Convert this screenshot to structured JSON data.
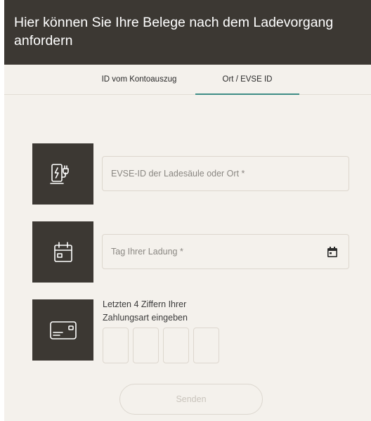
{
  "header": {
    "title": "Hier können Sie Ihre Belege nach dem Ladevorgang anfordern"
  },
  "tabs": [
    {
      "label": "ID vom Kontoauszug",
      "active": false
    },
    {
      "label": "Ort / EVSE ID",
      "active": true
    }
  ],
  "form": {
    "location": {
      "placeholder": "EVSE-ID der Ladesäule oder Ort *",
      "value": "",
      "icon": "charging-station-icon"
    },
    "date": {
      "placeholder": "Tag Ihrer Ladung *",
      "value": "",
      "icon": "calendar-icon",
      "picker_icon": "calendar-small-icon"
    },
    "card_digits": {
      "label_line1": "Letzten 4 Ziffern Ihrer",
      "label_line2": "Zahlungsart eingeben",
      "digits": [
        "",
        "",
        "",
        ""
      ],
      "icon": "credit-card-icon"
    },
    "submit": {
      "label": "Senden",
      "enabled": false
    }
  },
  "colors": {
    "header_bg": "#3c3833",
    "page_bg": "#f4f1ec",
    "active_tab_underline": "#3e8d86",
    "icon_box_bg": "#3c3833"
  }
}
